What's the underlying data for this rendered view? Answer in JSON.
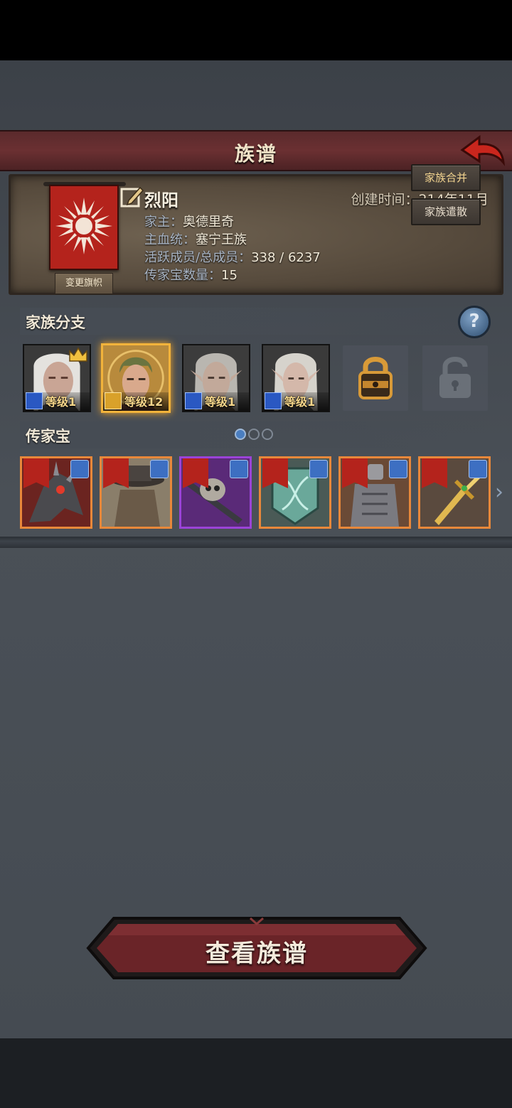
{
  "header": {
    "title": "族谱"
  },
  "clan": {
    "name": "烈阳",
    "created_label": "创建时间：",
    "created_value": "214年11月",
    "change_banner_label": "变更旗帜",
    "lines": [
      {
        "label": "家主：",
        "value": "奥德里奇"
      },
      {
        "label": "主血统：",
        "value": "塞宁王族"
      },
      {
        "label": "活跃成员/总成员：",
        "value": "338 / 6237"
      },
      {
        "label": "传家宝数量：",
        "value": "15"
      }
    ],
    "merge_label": "家族合并",
    "dissolve_label": "家族遣散"
  },
  "branches": {
    "title": "家族分支",
    "items": [
      {
        "level": "等级1",
        "role": "sword",
        "crown": true,
        "selected": false
      },
      {
        "level": "等级12",
        "role": "shield",
        "crown": false,
        "selected": true
      },
      {
        "level": "等级1",
        "role": "sword",
        "crown": false,
        "selected": false
      },
      {
        "level": "等级1",
        "role": "sword",
        "crown": false,
        "selected": false
      }
    ],
    "slots": [
      {
        "state": "locked-unlockable",
        "icon": "padlock-gold-icon"
      },
      {
        "state": "locked",
        "icon": "padlock-grey-icon"
      }
    ]
  },
  "heirlooms": {
    "title": "传家宝",
    "pages": 3,
    "current_page": 1,
    "items": [
      {
        "name": "heirloom-1",
        "rarity": "orange"
      },
      {
        "name": "heirloom-2",
        "rarity": "orange"
      },
      {
        "name": "heirloom-3",
        "rarity": "purple"
      },
      {
        "name": "heirloom-4",
        "rarity": "orange"
      },
      {
        "name": "heirloom-5",
        "rarity": "orange"
      },
      {
        "name": "heirloom-6",
        "rarity": "orange"
      }
    ]
  },
  "footer": {
    "view_button_label": "查看族谱"
  },
  "colors": {
    "accent_red": "#b4231c",
    "gold": "#f2b33b",
    "rarity_orange": "#e8883a",
    "rarity_purple": "#9b43d8"
  }
}
